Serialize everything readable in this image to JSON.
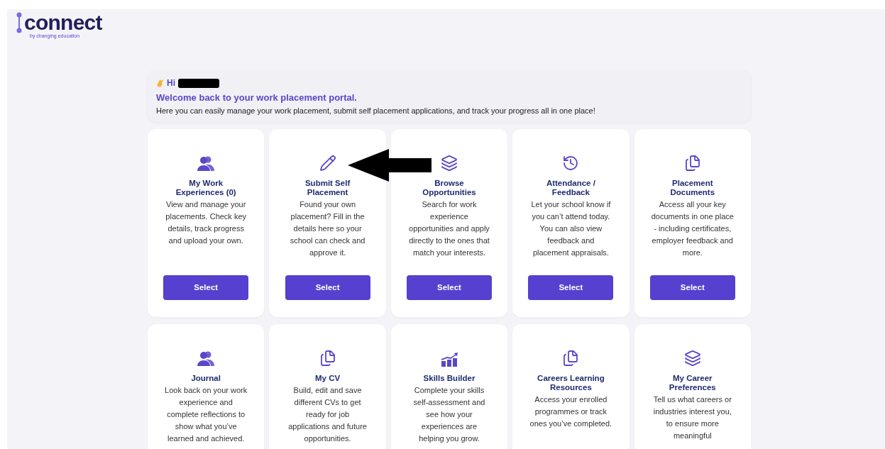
{
  "logo": {
    "name": "connect",
    "tagline": "by changing education"
  },
  "welcome": {
    "greeting": "Hi",
    "name_redacted": true,
    "title": "Welcome back to your work placement portal.",
    "text": "Here you can easily manage your work placement, submit self placement applications, and track your progress all in one place!"
  },
  "annotation_arrow": true,
  "cards": [
    {
      "kind": "people",
      "title": "My Work Experiences (0)",
      "text": "View and manage your placements. Check key details, track progress and upload your own.",
      "button": "Select"
    },
    {
      "kind": "pencil",
      "title": "Submit Self Placement",
      "text": "Found your own placement? Fill in the details here so your school can check and approve it.",
      "button": "Select"
    },
    {
      "kind": "layers",
      "title": "Browse Opportunities",
      "text": "Search for work experience opportunities and apply directly to the ones that match your interests.",
      "button": "Select"
    },
    {
      "kind": "history",
      "title": "Attendance / Feedback",
      "text": "Let your school know if you can’t attend today. You can also view feedback and placement appraisals.",
      "button": "Select"
    },
    {
      "kind": "documents",
      "title": "Placement Documents",
      "text": "Access all your key documents in one place - including certificates, employer feedback and more.",
      "button": "Select"
    },
    {
      "kind": "people",
      "title": "Journal",
      "text": "Look back on your work experience and complete reflections to show what you’ve learned and achieved."
    },
    {
      "kind": "documents",
      "title": "My CV",
      "text": "Build, edit and save different CVs to get ready for job applications and future opportunities."
    },
    {
      "kind": "chart",
      "title": "Skills Builder",
      "text": "Complete your skills self-assessment and see how your experiences are helping you grow."
    },
    {
      "kind": "documents",
      "title": "Careers Learning Resources",
      "text": "Access your enrolled programmes or track ones you’ve completed."
    },
    {
      "kind": "layers",
      "title": "My Career Preferences",
      "text": "Tell us what careers or industries interest you, to ensure more meaningful"
    }
  ]
}
